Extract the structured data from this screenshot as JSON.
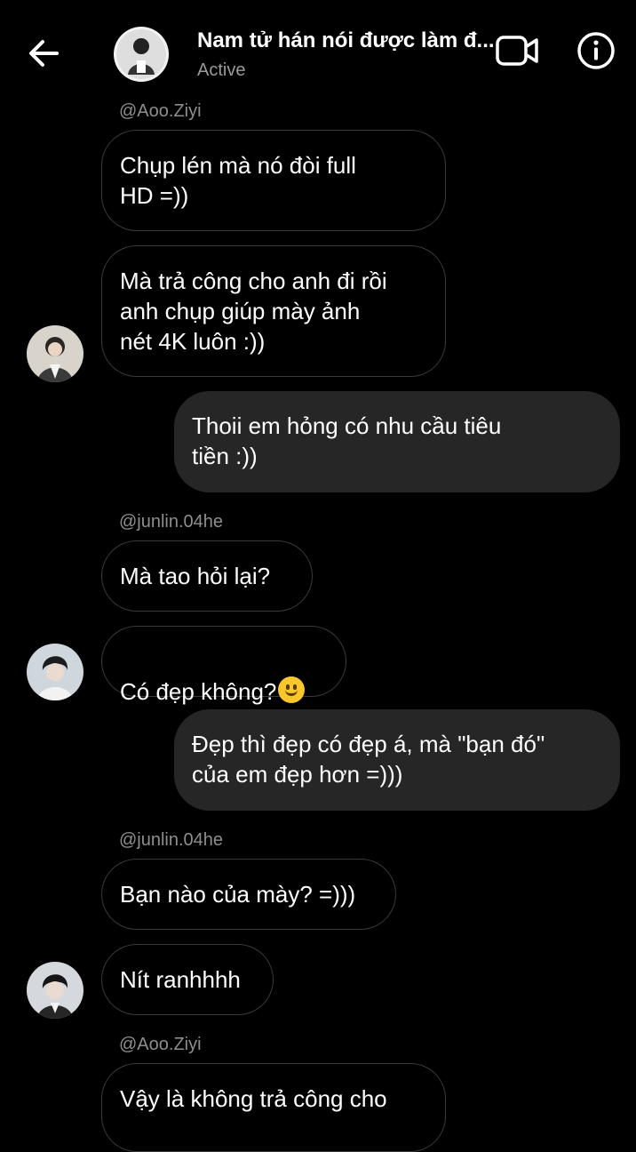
{
  "header": {
    "title": "Nam tử hán nói được làm đ...",
    "status": "Active"
  },
  "messages": {
    "handle_1": "@Aoo.Ziyi",
    "m1": "Chụp lén mà nó đòi full\nHD =))",
    "m2": "Mà trả công cho anh đi rồi\nanh chụp giúp mày ảnh\nnét 4K luôn :))",
    "m3": "Thoii em hỏng có nhu cầu tiêu\ntiền :))",
    "handle_2": "@junlin.04he",
    "m4": "Mà tao hỏi lại?",
    "m5": "Có đẹp không?",
    "m6": "Đẹp thì đẹp có đẹp á, mà \"bạn đó\"\ncủa em đẹp hơn =)))",
    "handle_3": "@junlin.04he",
    "m7": "Bạn nào của mày? =)))",
    "m8": "Nít ranhhhh",
    "handle_4": "@Aoo.Ziyi",
    "m9": "Vậy là không trả công cho"
  },
  "icons": {
    "back": "arrow-left-icon",
    "video": "video-camera-icon",
    "info": "info-icon",
    "emoji": "slightly-smiling-face"
  }
}
